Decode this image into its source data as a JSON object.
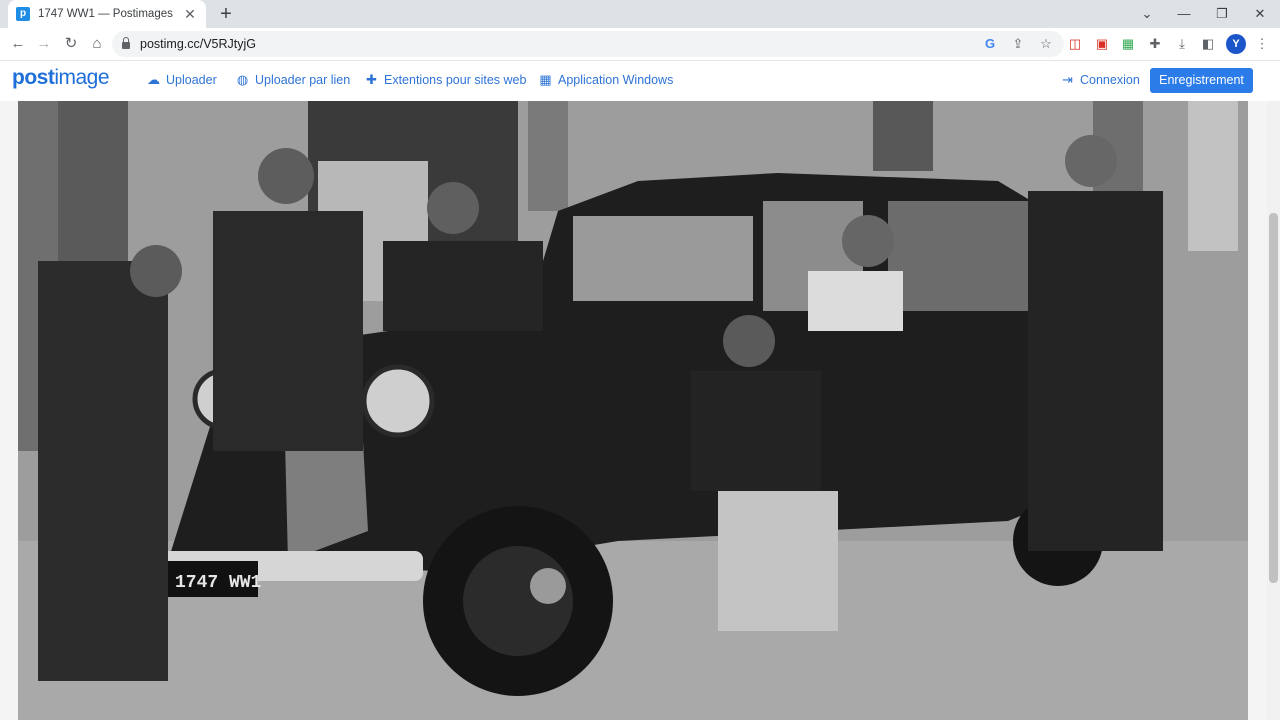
{
  "browser": {
    "tab_title": "1747 WW1 — Postimages",
    "favicon_letter": "p",
    "url": "postimg.cc/V5RJtyjG",
    "profile_initial": "Y",
    "icons": [
      "back-icon",
      "forward-icon",
      "reload-icon",
      "home-icon",
      "lock-icon",
      "google-icon",
      "share-icon",
      "star-icon",
      "extension-icons",
      "puzzle-icon",
      "download-icon",
      "sidepanel-icon",
      "menu-icon"
    ]
  },
  "site": {
    "logo_bold": "post",
    "logo_thin": "image",
    "nav": [
      {
        "icon": "cloud-upload-icon",
        "label": "Uploader"
      },
      {
        "icon": "globe-icon",
        "label": "Uploader par lien"
      },
      {
        "icon": "puzzle-icon",
        "label": "Extentions pour sites web"
      },
      {
        "icon": "windows-icon",
        "label": "Application Windows"
      }
    ],
    "login_label": "Connexion",
    "register_label": "Enregistrement"
  },
  "photo": {
    "plate_text": "1747 WW1",
    "subject": "vintage car photo"
  },
  "colors": {
    "accent": "#2b7ce9",
    "link": "#2e74d6",
    "tabstrip": "#dee1e6"
  }
}
